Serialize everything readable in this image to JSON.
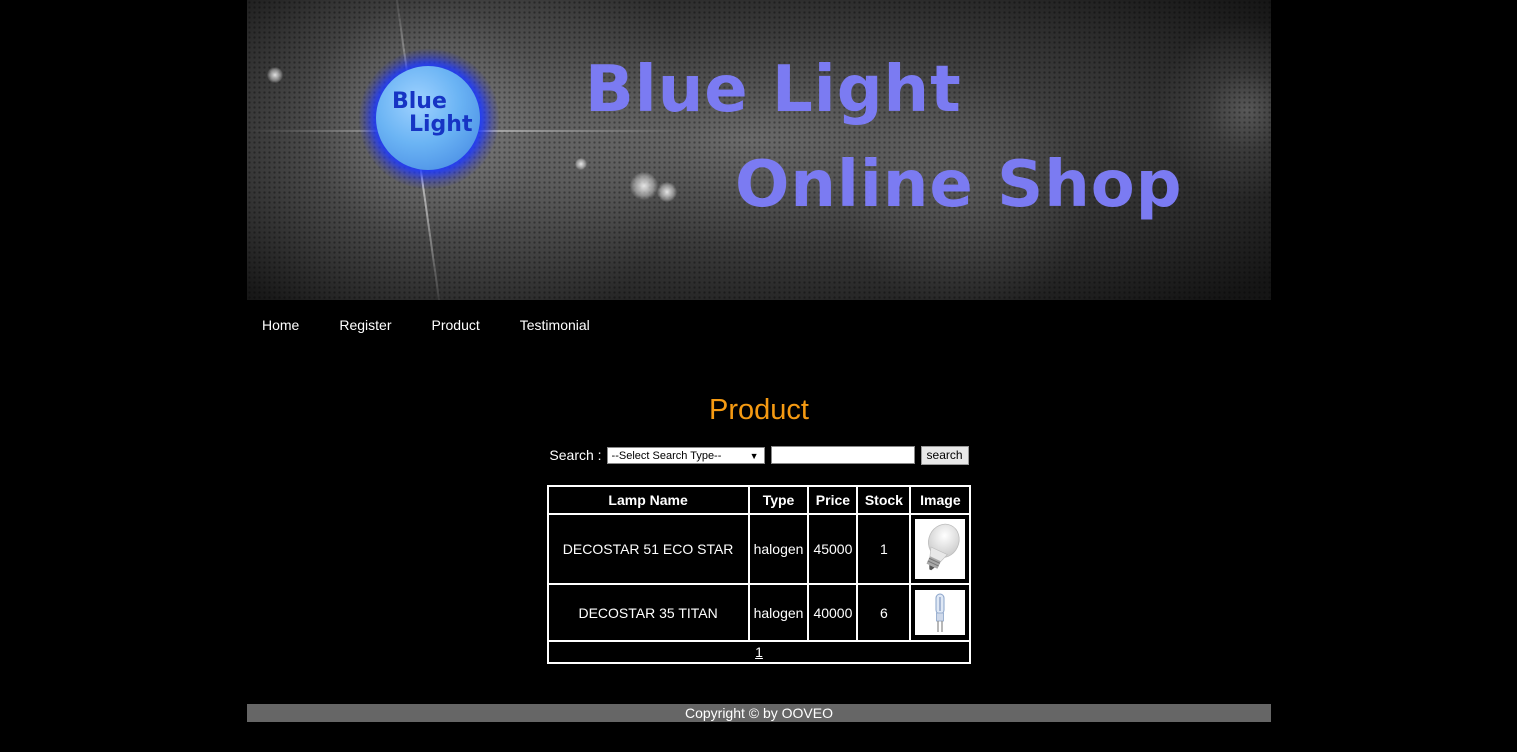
{
  "banner": {
    "logo_line1": "Blue",
    "logo_line2": "Light",
    "title_line1": "Blue Light",
    "title_line2": "Online Shop"
  },
  "nav": {
    "items": [
      {
        "label": "Home"
      },
      {
        "label": "Register"
      },
      {
        "label": "Product"
      },
      {
        "label": "Testimonial"
      }
    ]
  },
  "main": {
    "heading": "Product",
    "search": {
      "label": "Search :",
      "select_value": "--Select Search Type--",
      "input_value": "",
      "button_label": "search"
    },
    "table": {
      "headers": [
        "Lamp Name",
        "Type",
        "Price",
        "Stock",
        "Image"
      ],
      "rows": [
        {
          "name": "DECOSTAR 51 ECO STAR",
          "type": "halogen",
          "price": "45000",
          "stock": "1",
          "image": "led-bulb-image"
        },
        {
          "name": "DECOSTAR 35 TITAN",
          "type": "halogen",
          "price": "40000",
          "stock": "6",
          "image": "halogen-capsule-image"
        }
      ],
      "pager": "1"
    }
  },
  "footer": {
    "text": "Copyright © by OOVEO"
  },
  "colors": {
    "heading": "#f59a12",
    "title": "#7b7bf2",
    "footer_bg": "#666666",
    "background": "#000000"
  }
}
